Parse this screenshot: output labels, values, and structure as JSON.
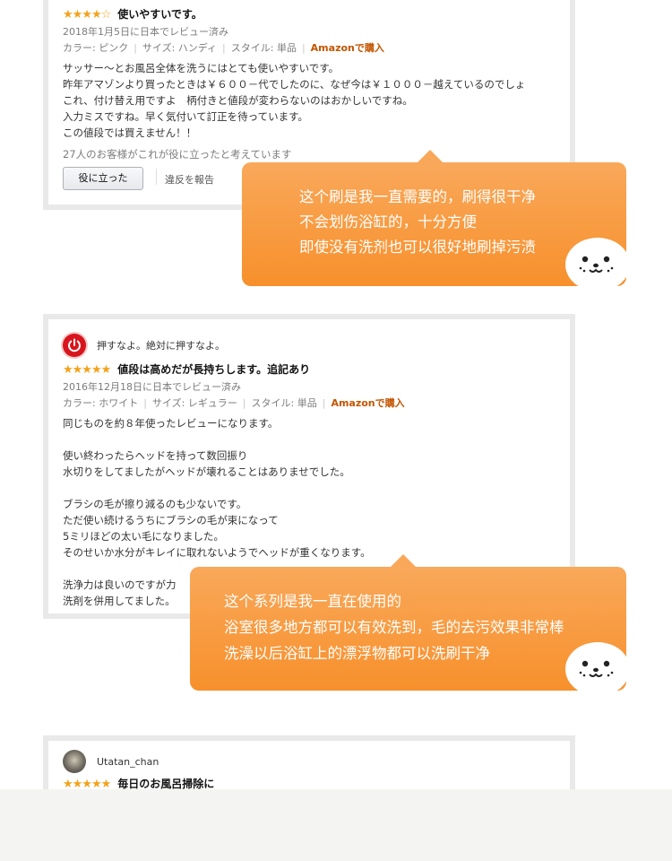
{
  "review1": {
    "stars": "★★★★☆",
    "title": "使いやすいです。",
    "date": "2018年1月5日に日本でレビュー済み",
    "color": "カラー: ピンク",
    "size": "サイズ: ハンディ",
    "style": "スタイル: 単品",
    "purchase": "Amazonで購入",
    "body": [
      "サッサー～とお風呂全体を洗うにはとても使いやすいです。",
      "昨年アマゾンより買ったときは￥６００－代でしたのに、なぜ今は￥１０００－越えているのでしょ",
      "これ、付け替え用ですよ　柄付きと値段が変わらないのはおかしいですね。",
      "入力ミスですね。早く気付いて訂正を待っています。",
      "この値段では買えません！！"
    ],
    "helpful_count": "27人のお客様がこれが役に立ったと考えています",
    "helpful_button": "役に立った",
    "report": "違反を報告"
  },
  "bubble1": {
    "lines": [
      "这个刷是我一直需要的，刷得很干净",
      "不会划伤浴缸的，十分方便",
      "即使没有洗剂也可以很好地刷掉污渍"
    ]
  },
  "review2": {
    "author": "押すなよ。絶対に押すなよ。",
    "stars": "★★★★★",
    "title": "値段は高めだが長持ちします。追記あり",
    "date": "2016年12月18日に日本でレビュー済み",
    "color": "カラー: ホワイト",
    "size": "サイズ: レギュラー",
    "style": "スタイル: 単品",
    "purchase": "Amazonで購入",
    "body": [
      "同じものを約８年使ったレビューになります。",
      "",
      "使い終わったらヘッドを持って数回振り",
      "水切りをしてましたがヘッドが壊れることはありませでした。",
      "",
      "ブラシの毛が擦り減るのも少ないです。",
      "ただ使い続けるうちにブラシの毛が束になって",
      "5ミリほどの太い毛になりました。",
      "そのせいか水分がキレイに取れないようでヘッドが重くなります。",
      "",
      "洗浄力は良いのですが力",
      "洗剤を併用してました。"
    ]
  },
  "bubble2": {
    "lines": [
      "这个系列是我一直在使用的",
      "浴室很多地方都可以有效洗到，毛的去污效果非常棒",
      "洗澡以后浴缸上的漂浮物都可以洗刷干净"
    ]
  },
  "review3": {
    "author": "Utatan_chan",
    "stars": "★★★★★",
    "title": "毎日のお風呂掃除に"
  }
}
